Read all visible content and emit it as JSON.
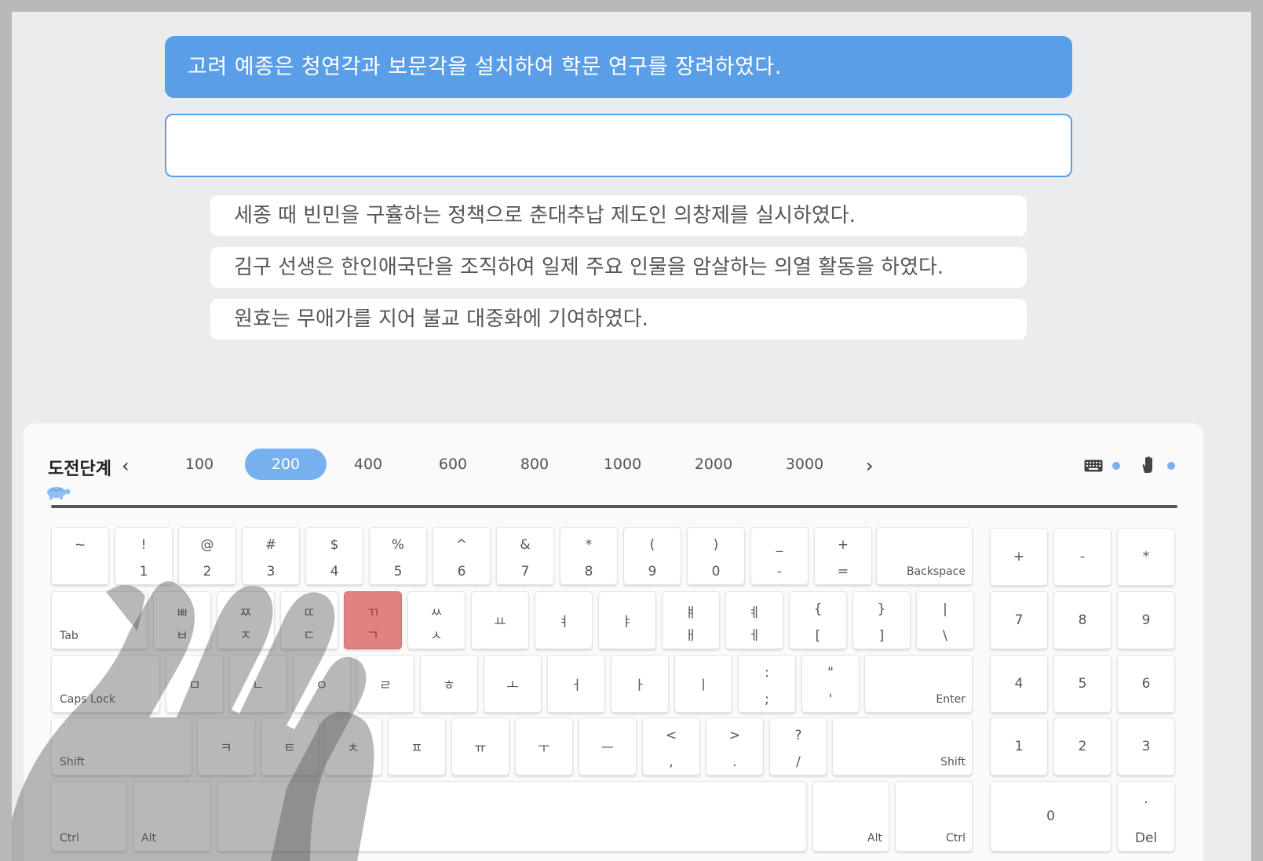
{
  "sentence": {
    "target": "고려 예종은 청연각과 보문각을 설치하여 학문 연구를 장려하였다.",
    "input_value": "",
    "upcoming": [
      "세종 때 빈민을 구휼하는 정책으로 춘대추납 제도인 의창제를 실시하였다.",
      "김구 선생은 한인애국단을 조직하여 일제 주요 인물을 암살하는 의열 활동을 하였다.",
      "원효는 무애가를 지어 불교 대중화에 기여하였다."
    ]
  },
  "challenge": {
    "label": "도전단계",
    "prev_icon": "chevron-left-icon",
    "next_icon": "chevron-right-icon",
    "levels": [
      "100",
      "200",
      "400",
      "600",
      "800",
      "1000",
      "2000",
      "3000"
    ],
    "active_level": "200",
    "progress": 1.0
  },
  "tools": {
    "keyboard_icon": "keyboard-icon",
    "hand_icon": "hand-icon",
    "accent_color": "#76b0ee"
  },
  "keyboard": {
    "row1": [
      {
        "top": "~",
        "bot": ""
      },
      {
        "top": "!",
        "bot": "1"
      },
      {
        "top": "@",
        "bot": "2"
      },
      {
        "top": "#",
        "bot": "3"
      },
      {
        "top": "$",
        "bot": "4"
      },
      {
        "top": "%",
        "bot": "5"
      },
      {
        "top": "^",
        "bot": "6"
      },
      {
        "top": "&",
        "bot": "7"
      },
      {
        "top": "*",
        "bot": "8"
      },
      {
        "top": "(",
        "bot": "9"
      },
      {
        "top": ")",
        "bot": "0"
      },
      {
        "top": "_",
        "bot": "-"
      },
      {
        "top": "+",
        "bot": "="
      }
    ],
    "backspace": "Backspace",
    "tab": "Tab",
    "row2": [
      {
        "top": "ㅃ",
        "bot": "ㅂ"
      },
      {
        "top": "ㅉ",
        "bot": "ㅈ"
      },
      {
        "top": "ㄸ",
        "bot": "ㄷ"
      },
      {
        "top": "ㄲ",
        "bot": "ㄱ"
      },
      {
        "top": "ㅆ",
        "bot": "ㅅ"
      },
      {
        "top": "",
        "bot": "",
        "mid": "ㅛ"
      },
      {
        "top": "",
        "bot": "",
        "mid": "ㅕ"
      },
      {
        "top": "",
        "bot": "",
        "mid": "ㅑ"
      },
      {
        "top": "ㅒ",
        "bot": "ㅐ"
      },
      {
        "top": "ㅖ",
        "bot": "ㅔ"
      },
      {
        "top": "{",
        "bot": "["
      },
      {
        "top": "}",
        "bot": "]"
      },
      {
        "top": "|",
        "bot": "\\"
      }
    ],
    "highlighted_key": "ㄱ",
    "caps_lock": "Caps Lock",
    "row3": [
      {
        "mid": "ㅁ"
      },
      {
        "mid": "ㄴ"
      },
      {
        "mid": "ㅇ"
      },
      {
        "mid": "ㄹ"
      },
      {
        "mid": "ㅎ"
      },
      {
        "mid": "ㅗ"
      },
      {
        "mid": "ㅓ"
      },
      {
        "mid": "ㅏ"
      },
      {
        "mid": "ㅣ"
      },
      {
        "top": ":",
        "bot": ";"
      },
      {
        "top": "\"",
        "bot": "'"
      }
    ],
    "enter": "Enter",
    "shift": "Shift",
    "row4": [
      {
        "mid": "ㅋ"
      },
      {
        "mid": "ㅌ"
      },
      {
        "mid": "ㅊ"
      },
      {
        "mid": "ㅍ"
      },
      {
        "mid": "ㅠ"
      },
      {
        "mid": "ㅜ"
      },
      {
        "mid": "ㅡ"
      },
      {
        "top": "<",
        "bot": ","
      },
      {
        "top": ">",
        "bot": "."
      },
      {
        "top": "?",
        "bot": "/"
      }
    ],
    "ctrl": "Ctrl",
    "alt": "Alt",
    "numpad": {
      "row1": [
        "+",
        "-",
        "*"
      ],
      "row2": [
        "7",
        "8",
        "9"
      ],
      "row3": [
        "4",
        "5",
        "6"
      ],
      "row4": [
        "1",
        "2",
        "3"
      ],
      "zero": "0",
      "dot": ".",
      "del": "Del"
    }
  }
}
